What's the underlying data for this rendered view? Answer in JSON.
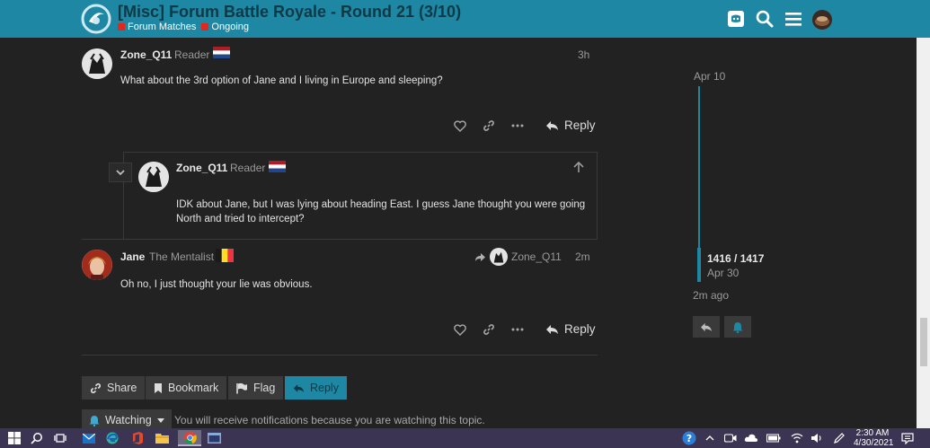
{
  "header": {
    "title": "[Misc] Forum Battle Royale - Round 21 (3/10)",
    "categories": [
      {
        "label": "Forum Matches",
        "color": "#e0281d"
      },
      {
        "label": "Ongoing",
        "color": "#e0281d"
      }
    ],
    "icons": [
      "discord-icon",
      "search-icon",
      "hamburger-menu-icon",
      "user-avatar"
    ]
  },
  "posts": [
    {
      "username": "Zone_Q11",
      "user_title": "Reader",
      "flag": "netherlands",
      "time": "3h",
      "text": "What about the 3rd option of Jane and I living in Europe and sleeping?",
      "reply_label": "Reply"
    },
    {
      "username": "Zone_Q11",
      "user_title": "Reader",
      "flag": "netherlands",
      "text": "IDK about Jane, but I was lying about heading East. I guess Jane thought you were going North and tried to intercept?"
    },
    {
      "username": "Jane",
      "user_title": "The Mentalist",
      "flag": "belgium",
      "reply_to": "Zone_Q11",
      "time": "2m",
      "text": "Oh no, I just thought your lie was obvious.",
      "reply_label": "Reply"
    }
  ],
  "timeline": {
    "top_date": "Apr 10",
    "position": "1416 / 1417",
    "current_date": "Apr 30",
    "last_activity": "2m ago",
    "progress": 0.999
  },
  "footer_buttons": {
    "share": "Share",
    "bookmark": "Bookmark",
    "flag": "Flag",
    "reply": "Reply",
    "watching": "Watching",
    "notification_text": "You will receive notifications because you are watching this topic."
  },
  "taskbar": {
    "time": "2:30 AM",
    "date": "4/30/2021"
  },
  "colors": {
    "accent": "#1e87a3",
    "background": "#222222",
    "category": "#e0281d",
    "taskbar": "#3b3553"
  }
}
